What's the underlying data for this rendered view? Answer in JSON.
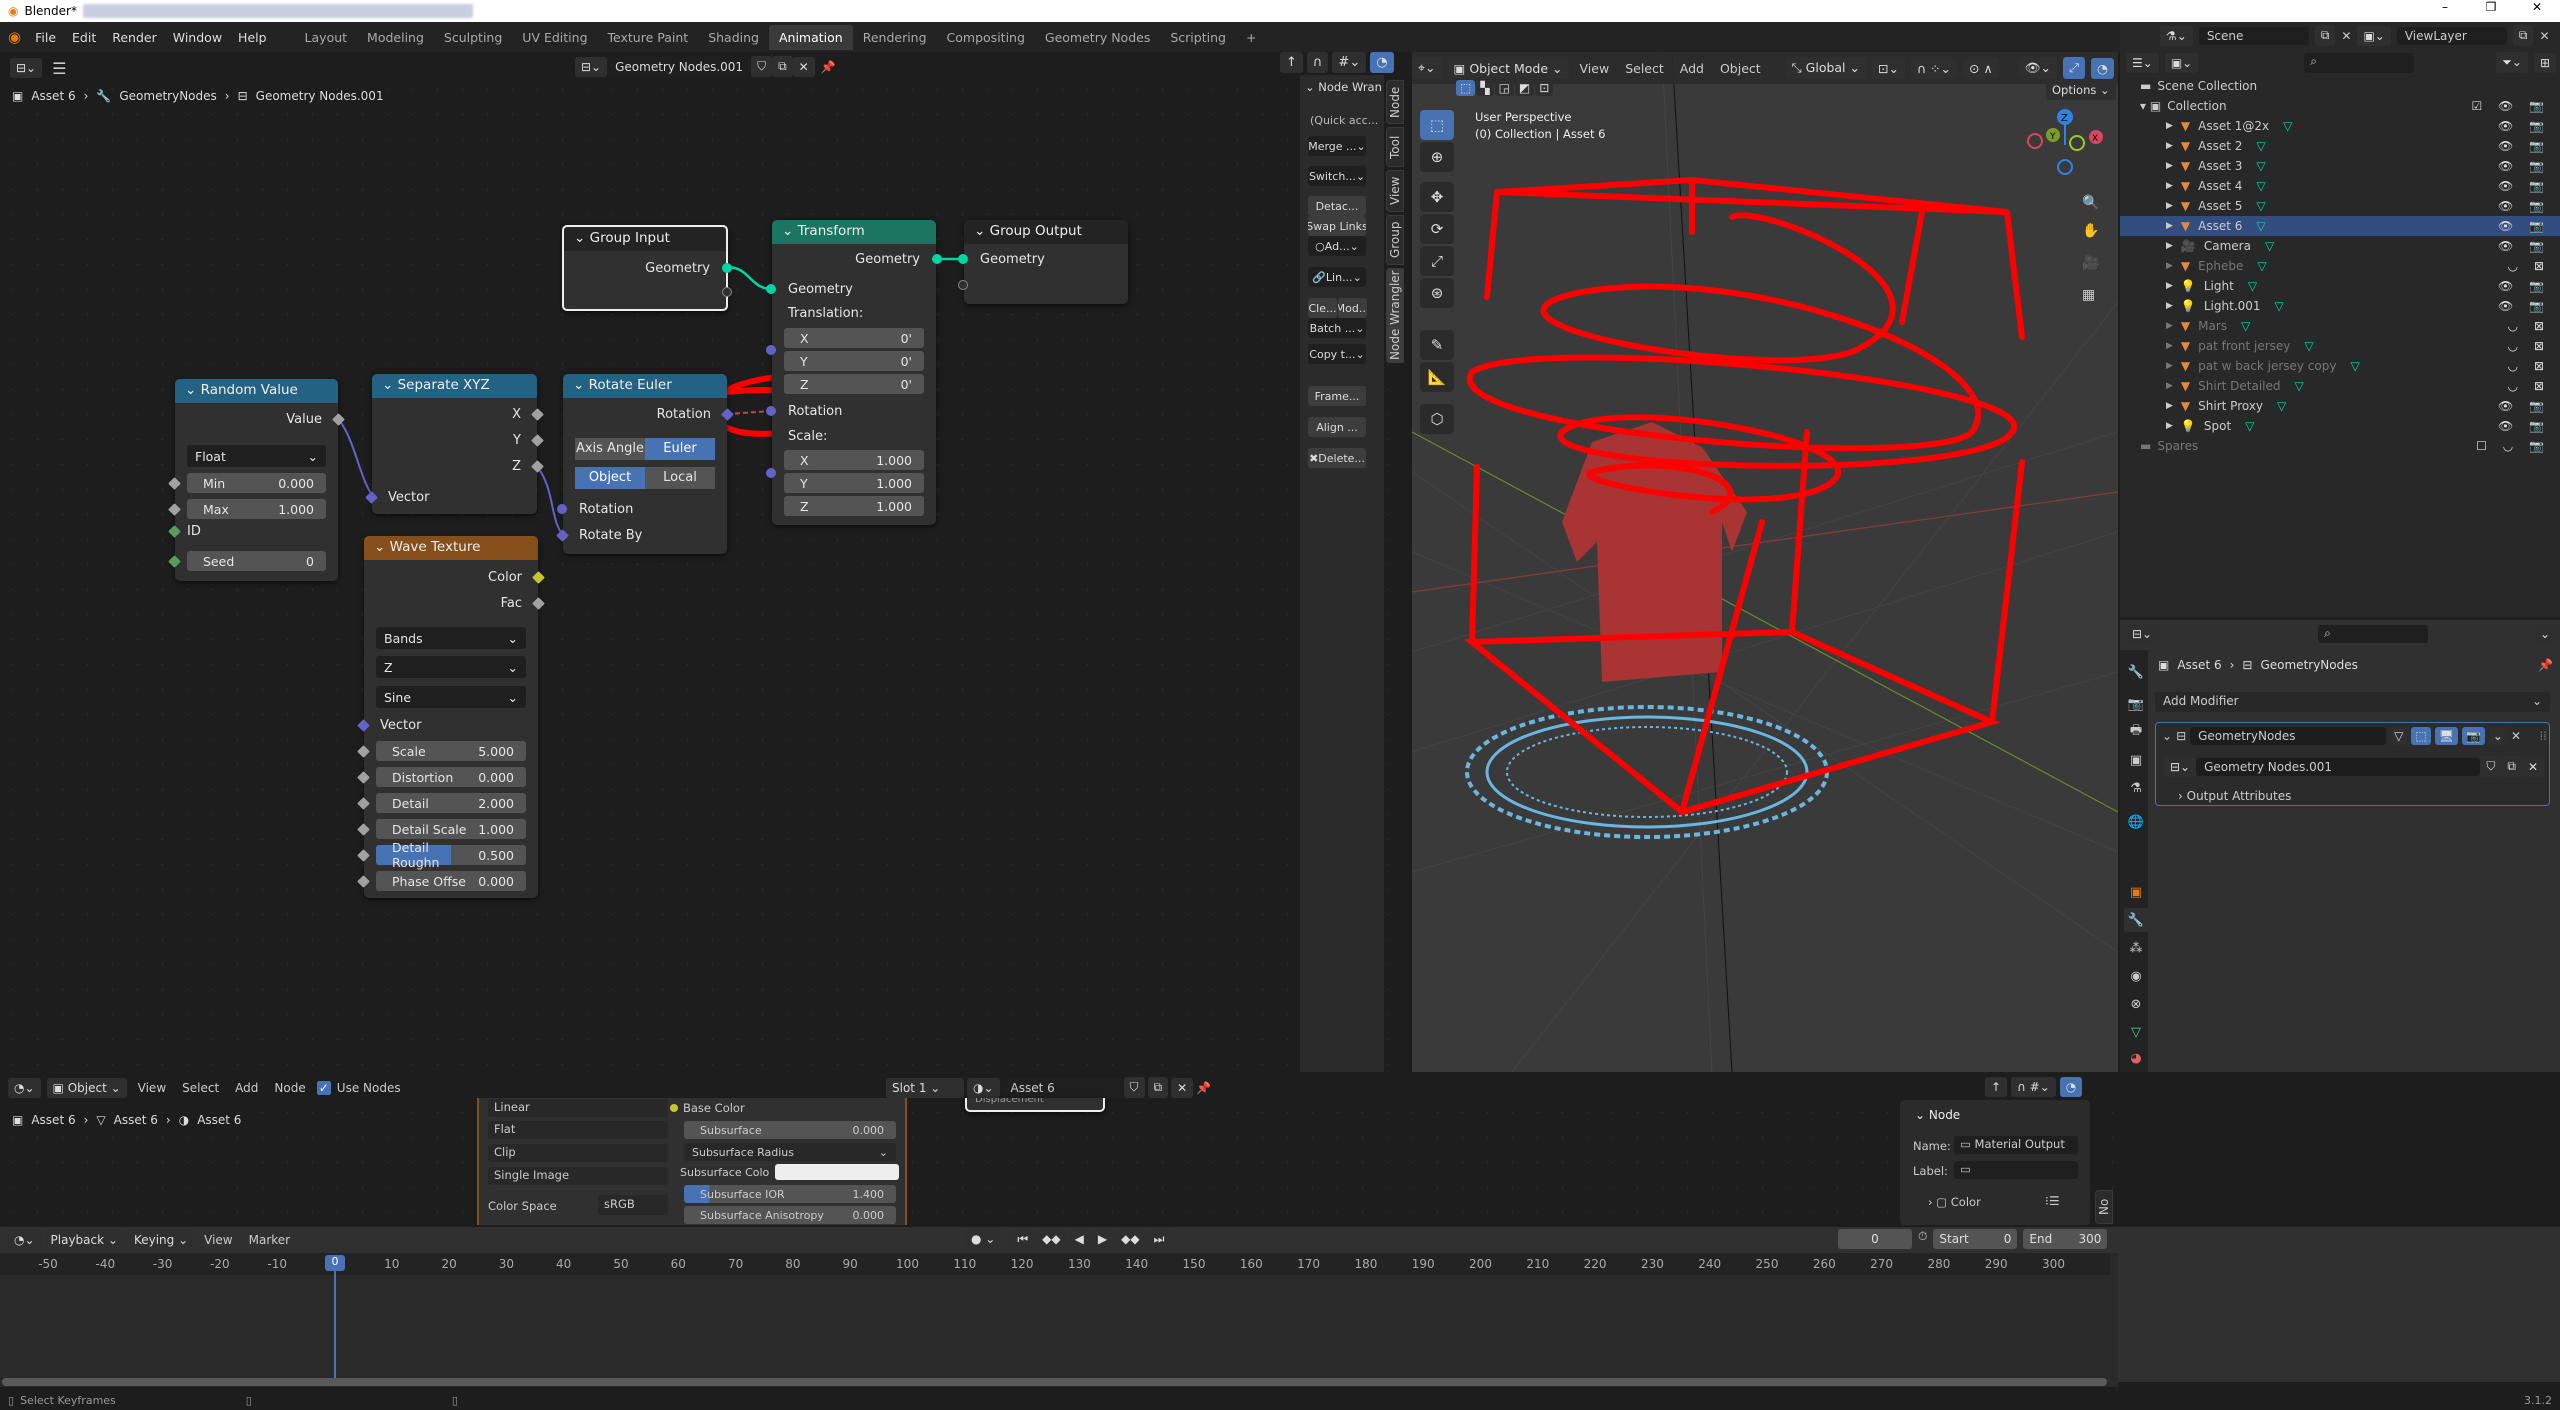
{
  "window": {
    "app_title": "Blender*",
    "controls": [
      "–",
      "❐",
      "✕"
    ]
  },
  "topbar": {
    "menus": [
      "File",
      "Edit",
      "Render",
      "Window",
      "Help"
    ],
    "workspaces": [
      "Layout",
      "Modeling",
      "Sculpting",
      "UV Editing",
      "Texture Paint",
      "Shading",
      "Animation",
      "Rendering",
      "Compositing",
      "Geometry Nodes",
      "Scripting"
    ],
    "active_workspace": "Animation",
    "add_tab": "+"
  },
  "node_editor": {
    "tree_name": "Geometry Nodes.001",
    "breadcrumb": [
      "Asset 6",
      "GeometryNodes",
      "Geometry Nodes.001"
    ],
    "nodes": {
      "group_input": {
        "title": "Group Input",
        "output": "Geometry"
      },
      "transform": {
        "title": "Transform",
        "output": "Geometry",
        "input_geometry": "Geometry",
        "translation_label": "Translation:",
        "translation": [
          {
            "axis": "X",
            "value": "0'"
          },
          {
            "axis": "Y",
            "value": "0'"
          },
          {
            "axis": "Z",
            "value": "0'"
          }
        ],
        "rotation_label": "Rotation",
        "scale_label": "Scale:",
        "scale": [
          {
            "axis": "X",
            "value": "1.000"
          },
          {
            "axis": "Y",
            "value": "1.000"
          },
          {
            "axis": "Z",
            "value": "1.000"
          }
        ]
      },
      "group_output": {
        "title": "Group Output",
        "input": "Geometry"
      },
      "random_value": {
        "title": "Random Value",
        "output": "Value",
        "type": "Float",
        "min_label": "Min",
        "min": "0.000",
        "max_label": "Max",
        "max": "1.000",
        "id_label": "ID",
        "seed_label": "Seed",
        "seed": "0"
      },
      "separate_xyz": {
        "title": "Separate XYZ",
        "outputs": [
          "X",
          "Y",
          "Z"
        ],
        "input": "Vector"
      },
      "rotate_euler": {
        "title": "Rotate Euler",
        "output": "Rotation",
        "mode_options": [
          "Axis Angle",
          "Euler"
        ],
        "mode_selected": "Euler",
        "space_options": [
          "Object",
          "Local"
        ],
        "space_selected": "Object",
        "inputs": [
          "Rotation",
          "Rotate By"
        ]
      },
      "wave_texture": {
        "title": "Wave Texture",
        "outputs": [
          "Color",
          "Fac"
        ],
        "wave_type": "Bands",
        "direction": "Z",
        "profile": "Sine",
        "vector_label": "Vector",
        "fields": [
          {
            "label": "Scale",
            "value": "5.000"
          },
          {
            "label": "Distortion",
            "value": "0.000"
          },
          {
            "label": "Detail",
            "value": "2.000"
          },
          {
            "label": "Detail Scale",
            "value": "1.000"
          },
          {
            "label": "Detail Roughn",
            "value": "0.500"
          },
          {
            "label": "Phase Offse",
            "value": "0.000"
          }
        ]
      }
    }
  },
  "node_wrangler": {
    "header": "Node Wran",
    "items": [
      "(Quick acc...",
      "Merge ...",
      "Switch...",
      "Detac...",
      "Swap Links",
      "Ad...",
      "Lin...",
      "Cle...",
      "Mod...",
      "Batch ...",
      "Copy t...",
      "Frame...",
      "Align ...",
      "Delete..."
    ],
    "tabs": [
      "Node",
      "Tool",
      "View",
      "Group",
      "Node Wrangler"
    ]
  },
  "viewport": {
    "mode": "Object Mode",
    "menus": [
      "View",
      "Select",
      "Add",
      "Object"
    ],
    "orientation": "Global",
    "options_label": "Options",
    "view_name": "User Perspective",
    "collection_info": "(0) Collection | Asset 6",
    "gizmo_axes": [
      "X",
      "Y",
      "Z"
    ]
  },
  "outliner": {
    "scene": "Scene",
    "view_layer": "ViewLayer",
    "root": "Scene Collection",
    "collection": "Collection",
    "items": [
      {
        "name": "Asset 1@2x",
        "type": "mesh",
        "dim": false,
        "selected": false
      },
      {
        "name": "Asset 2",
        "type": "mesh",
        "dim": false,
        "selected": false
      },
      {
        "name": "Asset 3",
        "type": "mesh",
        "dim": false,
        "selected": false
      },
      {
        "name": "Asset 4",
        "type": "mesh",
        "dim": false,
        "selected": false
      },
      {
        "name": "Asset 5",
        "type": "mesh",
        "dim": false,
        "selected": false
      },
      {
        "name": "Asset 6",
        "type": "mesh",
        "dim": false,
        "selected": true
      },
      {
        "name": "Camera",
        "type": "camera",
        "dim": false,
        "selected": false
      },
      {
        "name": "Ephebe",
        "type": "mesh",
        "dim": true,
        "selected": false
      },
      {
        "name": "Light",
        "type": "light",
        "dim": false,
        "selected": false
      },
      {
        "name": "Light.001",
        "type": "light",
        "dim": false,
        "selected": false
      },
      {
        "name": "Mars",
        "type": "mesh",
        "dim": true,
        "selected": false
      },
      {
        "name": "pat front jersey",
        "type": "mesh",
        "dim": true,
        "selected": false
      },
      {
        "name": "pat w back jersey copy",
        "type": "mesh",
        "dim": true,
        "selected": false
      },
      {
        "name": "Shirt Detailed",
        "type": "mesh",
        "dim": true,
        "selected": false
      },
      {
        "name": "Shirt Proxy",
        "type": "mesh",
        "dim": false,
        "selected": false
      },
      {
        "name": "Spot",
        "type": "light",
        "dim": false,
        "selected": false
      }
    ],
    "spares": "Spares"
  },
  "properties": {
    "breadcrumb": [
      "Asset 6",
      "GeometryNodes"
    ],
    "add_modifier": "Add Modifier",
    "modifier_name": "GeometryNodes",
    "node_group": "Geometry Nodes.001",
    "output_attributes": "Output Attributes"
  },
  "shader_editor": {
    "object_mode": "Object",
    "menus": [
      "View",
      "Select",
      "Add",
      "Node"
    ],
    "use_nodes_label": "Use Nodes",
    "use_nodes": true,
    "slot": "Slot 1",
    "material": "Asset 6",
    "breadcrumb": [
      "Asset 6",
      "Asset 6",
      "Asset 6"
    ],
    "image_node_rows": [
      "Linear",
      "Flat",
      "Clip",
      "Single Image"
    ],
    "color_space_label": "Color Space",
    "color_space": "sRGB",
    "bsdf_rows": [
      {
        "label": "Base Color",
        "value": ""
      },
      {
        "label": "Subsurface",
        "value": "0.000"
      },
      {
        "label": "Subsurface Radius",
        "value": ""
      },
      {
        "label": "Subsurface Colo",
        "value": ""
      },
      {
        "label": "Subsurface IOR",
        "value": "1.400"
      },
      {
        "label": "Subsurface Anisotropy",
        "value": "0.000"
      }
    ],
    "displacement_label": "Displacement",
    "node_panel": {
      "header": "Node",
      "name_label": "Name:",
      "name": "Material Output",
      "label_label": "Label:",
      "label": "",
      "color_label": "Color",
      "tab": "No"
    }
  },
  "timeline": {
    "menus": [
      "Playback",
      "Keying",
      "View",
      "Marker"
    ],
    "current_frame": "0",
    "start_label": "Start",
    "start": "0",
    "end_label": "End",
    "end": "300",
    "ticks": [
      "-50",
      "-40",
      "-30",
      "-20",
      "-10",
      "0",
      "10",
      "20",
      "30",
      "40",
      "50",
      "60",
      "70",
      "80",
      "90",
      "100",
      "110",
      "120",
      "130",
      "140",
      "150",
      "160",
      "170",
      "180",
      "190",
      "200",
      "210",
      "220",
      "230",
      "240",
      "250",
      "260",
      "270",
      "280",
      "290",
      "300"
    ]
  },
  "statusbar": {
    "hint": "Select Keyframes",
    "version": "3.1.2"
  }
}
